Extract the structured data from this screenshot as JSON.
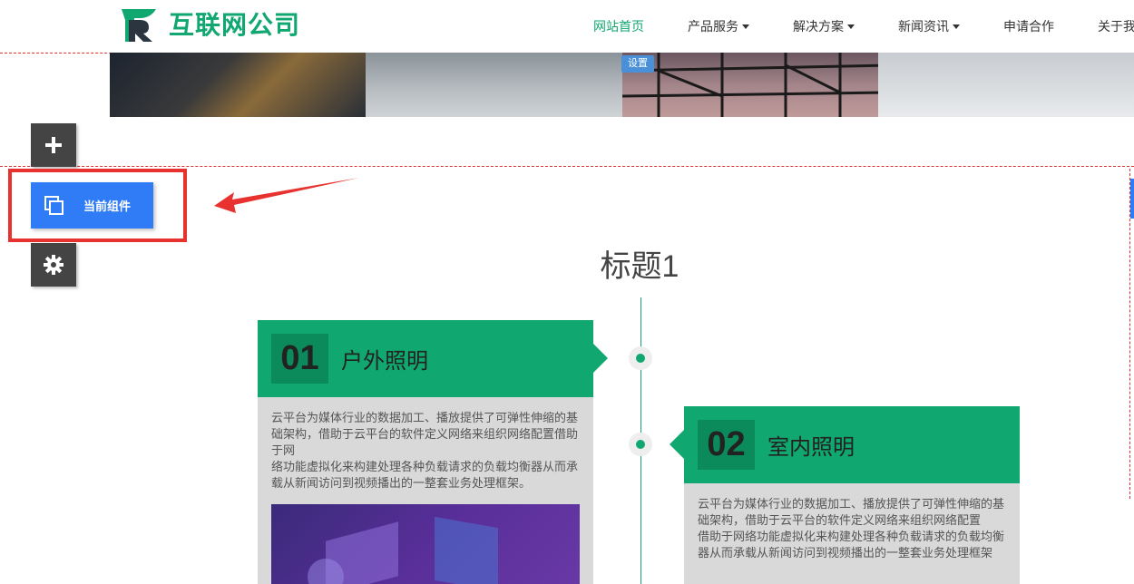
{
  "brand": {
    "name": "互联网公司",
    "accent": "#10a770"
  },
  "nav": {
    "items": [
      {
        "label": "网站首页",
        "active": true,
        "dropdown": false
      },
      {
        "label": "产品服务",
        "active": false,
        "dropdown": true
      },
      {
        "label": "解决方案",
        "active": false,
        "dropdown": true
      },
      {
        "label": "新闻资讯",
        "active": false,
        "dropdown": true
      },
      {
        "label": "申请合作",
        "active": false,
        "dropdown": false
      },
      {
        "label": "关于我",
        "active": false,
        "dropdown": false
      }
    ]
  },
  "banner": {
    "settings_label": "设置"
  },
  "toolbar": {
    "add_icon": "plus-icon",
    "current_component_label": "当前组件",
    "current_component_icon": "copy-icon",
    "settings_icon": "gear-icon",
    "highlight_color": "#e8322f",
    "button_color": "#2f7cf6"
  },
  "section": {
    "title": "标题1"
  },
  "cards": [
    {
      "number": "01",
      "title": "户外照明",
      "body_line1": "云平台为媒体行业的数据加工、播放提供了可弹性伸缩的基础架构，借助于云平台的软件定义网络来组织网络配置借助于网",
      "body_line2": "络功能虚拟化来构建处理各种负载请求的负载均衡器从而承载从新闻访问到视频播出的一整套业务处理框架。"
    },
    {
      "number": "02",
      "title": "室内照明",
      "body_line1": "云平台为媒体行业的数据加工、播放提供了可弹性伸缩的基础架构，借助于云平台的软件定义网络来组织网络配置",
      "body_line2": "借助于网络功能虚拟化来构建处理各种负载请求的负载均衡器从而承载从新闻访问到视频播出的一整套业务处理框架"
    }
  ]
}
